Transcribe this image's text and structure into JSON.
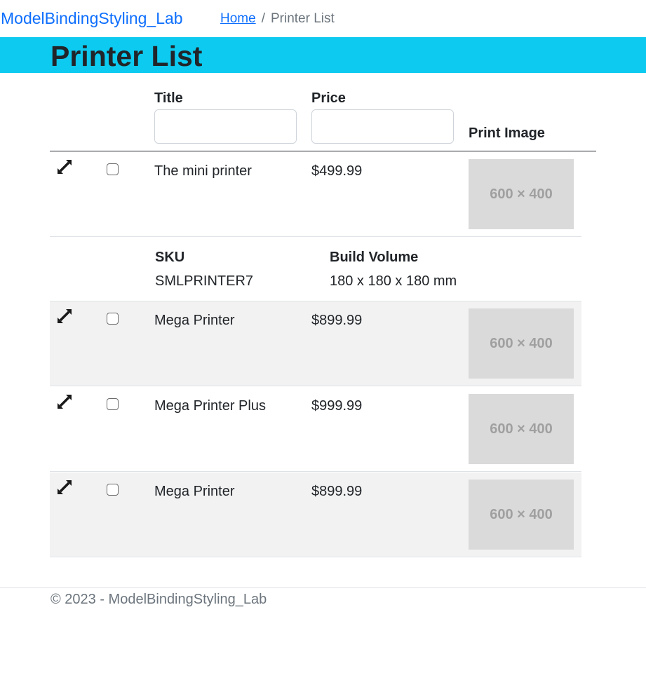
{
  "nav": {
    "brand": "ModelBindingStyling_Lab",
    "breadcrumb": {
      "home": "Home",
      "separator": "/",
      "current": "Printer List"
    }
  },
  "page": {
    "title": "Printer List",
    "banner_color": "#0dcaf0"
  },
  "table": {
    "headers": {
      "title": "Title",
      "price": "Price",
      "image": "Print Image"
    },
    "filters": {
      "title_value": "",
      "price_value": ""
    },
    "rows": [
      {
        "title": "The mini printer",
        "price": "$499.99",
        "image": "600 × 400"
      },
      {
        "title": "Mega Printer",
        "price": "$899.99",
        "image": "600 × 400"
      },
      {
        "title": "Mega Printer Plus",
        "price": "$999.99",
        "image": "600 × 400"
      },
      {
        "title": "Mega Printer",
        "price": "$899.99",
        "image": "600 × 400"
      }
    ],
    "detail": {
      "sku_label": "SKU",
      "sku_value": "SMLPRINTER7",
      "volume_label": "Build Volume",
      "volume_value": "180 x 180 x 180 mm"
    },
    "row_icon": "expand-arrows-icon"
  },
  "footer": {
    "text": "© 2023 - ModelBindingStyling_Lab"
  }
}
